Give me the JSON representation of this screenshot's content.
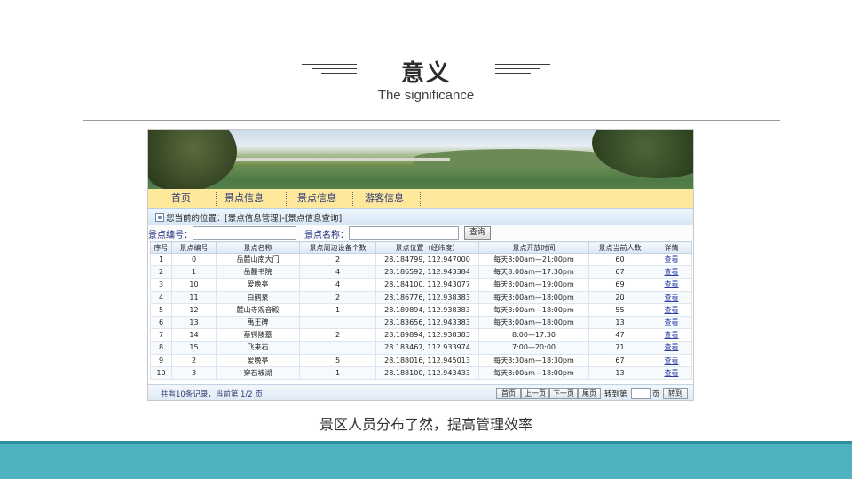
{
  "slide": {
    "title": "意义",
    "subtitle": "The significance",
    "caption": "景区人员分布了然，提高管理效率"
  },
  "app": {
    "nav": [
      "首页",
      "景点信息",
      "景点信息",
      "游客信息"
    ],
    "location_label": "您当前的位置：",
    "location_path": "[景点信息管理]-[景点信息查询]",
    "search": {
      "id_label": "景点编号：",
      "name_label": "景点名称：",
      "button": "查询",
      "id_value": "",
      "name_value": ""
    },
    "table": {
      "columns": [
        "序号",
        "景点编号",
        "景点名称",
        "景点周边设备个数",
        "景点位置（经纬度）",
        "景点开放时间",
        "景点当前人数",
        "详情"
      ],
      "rows": [
        [
          "1",
          "0",
          "岳麓山南大门",
          "2",
          "28.184799, 112.947000",
          "每天8:00am—21:00pm",
          "60",
          "查看"
        ],
        [
          "2",
          "1",
          "岳麓书院",
          "4",
          "28.186592, 112.943384",
          "每天8:00am—17:30pm",
          "67",
          "查看"
        ],
        [
          "3",
          "10",
          "爱晚亭",
          "4",
          "28.184100, 112.943077",
          "每天8:00am—19:00pm",
          "69",
          "查看"
        ],
        [
          "4",
          "11",
          "白鹤泉",
          "2",
          "28.186776, 112.938383",
          "每天8:00am—18:00pm",
          "20",
          "查看"
        ],
        [
          "5",
          "12",
          "麓山寺观音殿",
          "1",
          "28.189894, 112.938383",
          "每天8:00am—18:00pm",
          "55",
          "查看"
        ],
        [
          "6",
          "13",
          "禹王碑",
          "",
          "28.183656, 112.943383",
          "每天8:00am—18:00pm",
          "13",
          "查看"
        ],
        [
          "7",
          "14",
          "蔡锷陵墓",
          "2",
          "28.189894, 112.938383",
          "8:00—17:30",
          "47",
          "查看"
        ],
        [
          "8",
          "15",
          "飞来石",
          "",
          "28.183467, 112.933974",
          "7:00—20:00",
          "71",
          "查看"
        ],
        [
          "9",
          "2",
          "爱晚亭",
          "5",
          "28.188016, 112.945013",
          "每天8:30am—18:30pm",
          "67",
          "查看"
        ],
        [
          "10",
          "3",
          "穿石坡湖",
          "1",
          "28.188100, 112.943433",
          "每天8:00am—18:00pm",
          "13",
          "查看"
        ]
      ]
    },
    "pager": {
      "info": "共有10条记录，当前第 1/2 页",
      "first": "首页",
      "prev": "上一页",
      "next": "下一页",
      "last": "尾页",
      "goto_label": "转到第",
      "page_unit": "页",
      "go": "转到"
    }
  },
  "colors": {
    "navbar": "#fde89b",
    "bottom_band": "#4fb2c0",
    "link": "#2b3ea8"
  }
}
